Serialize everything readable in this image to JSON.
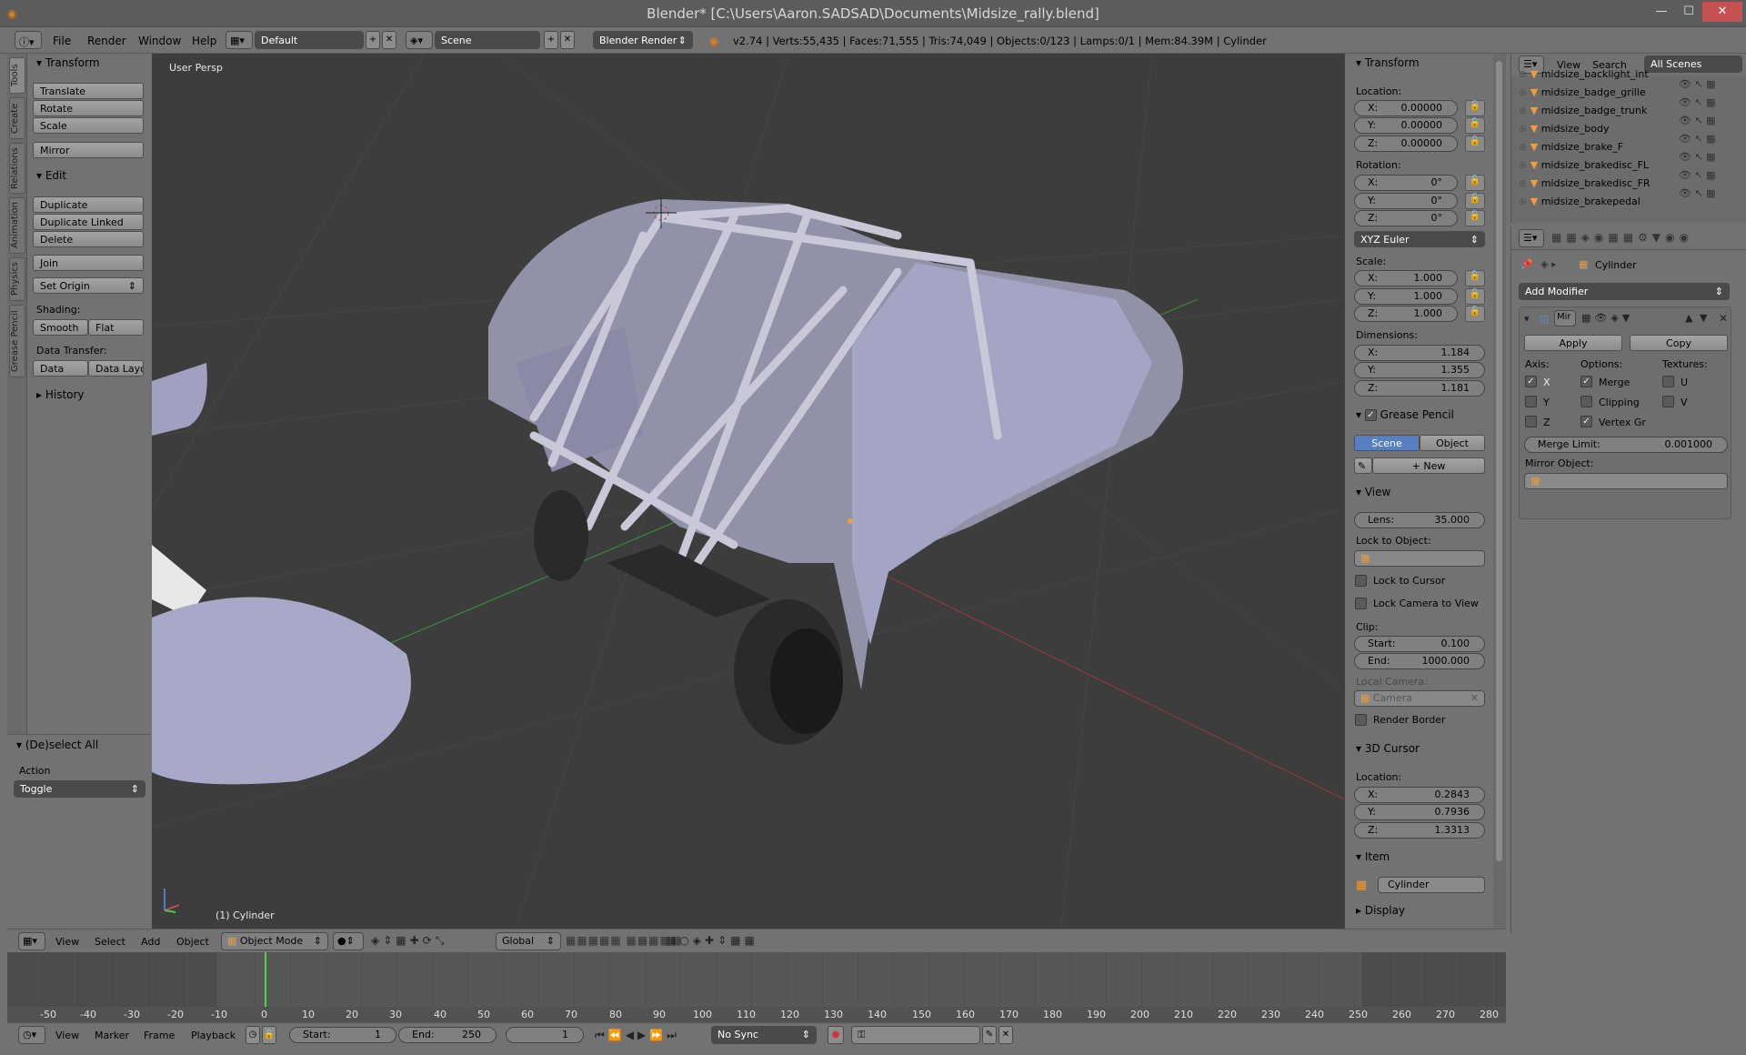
{
  "window": {
    "title": "Blender* [C:\\Users\\Aaron.SADSAD\\Documents\\Midsize_rally.blend]",
    "minimize": "—",
    "maximize": "☐",
    "close": "✕"
  },
  "menubar": {
    "items": [
      "File",
      "Render",
      "Window",
      "Help"
    ],
    "layout": "Default",
    "scene": "Scene",
    "engine": "Blender Render",
    "info": "v2.74 | Verts:55,435 | Faces:71,555 | Tris:74,049 | Objects:0/123 | Lamps:0/1 | Mem:84.39M | Cylinder"
  },
  "left_tabs": [
    "Tools",
    "Create",
    "Relations",
    "Animation",
    "Physics",
    "Grease Pencil"
  ],
  "toolshelf": {
    "transform_header": "Transform",
    "translate": "Translate",
    "rotate": "Rotate",
    "scale": "Scale",
    "mirror": "Mirror",
    "edit_header": "Edit",
    "duplicate": "Duplicate",
    "duplicate_linked": "Duplicate Linked",
    "delete": "Delete",
    "join": "Join",
    "set_origin": "Set Origin",
    "shading_label": "Shading:",
    "smooth": "Smooth",
    "flat": "Flat",
    "data_transfer_label": "Data Transfer:",
    "data": "Data",
    "data_layout": "Data Layo",
    "history_header": "History"
  },
  "operator": {
    "header": "(De)select All",
    "action_label": "Action",
    "action_value": "Toggle"
  },
  "viewport": {
    "view_label": "User Persp",
    "object_label": "(1) Cylinder"
  },
  "npanel": {
    "transform_header": "Transform",
    "location_label": "Location:",
    "location": [
      {
        "axis": "X:",
        "value": "0.00000"
      },
      {
        "axis": "Y:",
        "value": "0.00000"
      },
      {
        "axis": "Z:",
        "value": "0.00000"
      }
    ],
    "rotation_label": "Rotation:",
    "rotation": [
      {
        "axis": "X:",
        "value": "0°"
      },
      {
        "axis": "Y:",
        "value": "0°"
      },
      {
        "axis": "Z:",
        "value": "0°"
      }
    ],
    "rotation_mode": "XYZ Euler",
    "scale_label": "Scale:",
    "scale": [
      {
        "axis": "X:",
        "value": "1.000"
      },
      {
        "axis": "Y:",
        "value": "1.000"
      },
      {
        "axis": "Z:",
        "value": "1.000"
      }
    ],
    "dimensions_label": "Dimensions:",
    "dimensions": [
      {
        "axis": "X:",
        "value": "1.184"
      },
      {
        "axis": "Y:",
        "value": "1.355"
      },
      {
        "axis": "Z:",
        "value": "1.181"
      }
    ],
    "grease_header": "Grease Pencil",
    "gp_scene": "Scene",
    "gp_object": "Object",
    "gp_new": "New",
    "view_header": "View",
    "lens_label": "Lens:",
    "lens_value": "35.000",
    "lock_object_label": "Lock to Object:",
    "lock_cursor": "Lock to Cursor",
    "lock_camera": "Lock Camera to View",
    "clip_label": "Clip:",
    "clip_start_label": "Start:",
    "clip_start": "0.100",
    "clip_end_label": "End:",
    "clip_end": "1000.000",
    "local_camera_label": "Local Camera:",
    "camera": "Camera",
    "render_border": "Render Border",
    "cursor_header": "3D Cursor",
    "cursor_location_label": "Location:",
    "cursor": [
      {
        "axis": "X:",
        "value": "0.2843"
      },
      {
        "axis": "Y:",
        "value": "0.7936"
      },
      {
        "axis": "Z:",
        "value": "1.3313"
      }
    ],
    "item_header": "Item",
    "item_name": "Cylinder",
    "display_header": "Display"
  },
  "outliner": {
    "view": "View",
    "search": "Search",
    "filter": "All Scenes",
    "items": [
      "midsize_backlight_int",
      "midsize_badge_grille",
      "midsize_badge_trunk",
      "midsize_body",
      "midsize_brake_F",
      "midsize_brakedisc_FL",
      "midsize_brakedisc_FR",
      "midsize_brakepedal"
    ]
  },
  "properties": {
    "object_name": "Cylinder",
    "add_modifier": "Add Modifier",
    "modifier_name": "Mir",
    "apply": "Apply",
    "copy": "Copy",
    "axis_label": "Axis:",
    "options_label": "Options:",
    "textures_label": "Textures:",
    "axis_x": "X",
    "axis_y": "Y",
    "axis_z": "Z",
    "merge": "Merge",
    "clipping": "Clipping",
    "vertex_groups": "Vertex Gr",
    "tex_u": "U",
    "tex_v": "V",
    "merge_limit_label": "Merge Limit:",
    "merge_limit": "0.001000",
    "mirror_object_label": "Mirror Object:"
  },
  "viewport_header": {
    "view": "View",
    "select": "Select",
    "add": "Add",
    "object": "Object",
    "mode": "Object Mode",
    "orientation": "Global"
  },
  "timeline": {
    "ticks": [
      "-50",
      "-40",
      "-30",
      "-20",
      "-10",
      "0",
      "10",
      "20",
      "30",
      "40",
      "50",
      "60",
      "70",
      "80",
      "90",
      "100",
      "110",
      "120",
      "130",
      "140",
      "150",
      "160",
      "170",
      "180",
      "190",
      "200",
      "210",
      "220",
      "230",
      "240",
      "250",
      "260",
      "270",
      "280"
    ],
    "view": "View",
    "marker": "Marker",
    "frame": "Frame",
    "playback": "Playback",
    "start_label": "Start:",
    "start": "1",
    "end_label": "End:",
    "end": "250",
    "current": "1",
    "sync": "No Sync"
  }
}
